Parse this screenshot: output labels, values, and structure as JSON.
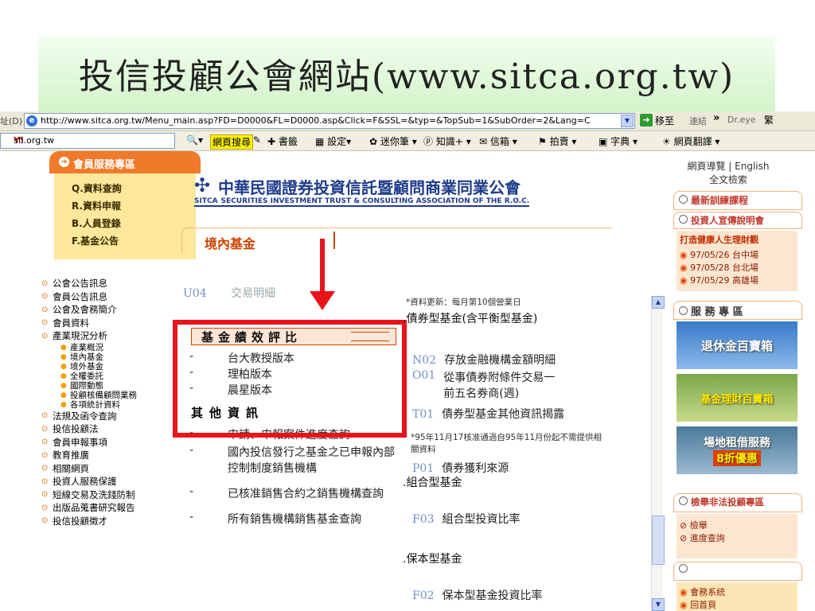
{
  "slide": {
    "title": "投信投顧公會網站(www.sitca.org.tw)"
  },
  "browser": {
    "address_label": "址(D)",
    "url": "http://www.sitca.org.tw/Menu_main.asp?FD=D0000&FL=D0000.asp&Click=F&SSL=&typ=&TopSub=1&SubOrder=2&Lang=C",
    "go_label": "移至",
    "links_label": "連結",
    "dreye_label": "Dr.eye",
    "dreye_extra": "繁",
    "search_value": "sfi.org.tw",
    "toolbar": {
      "web_search": "網頁搜尋",
      "bookmarks": "書籤",
      "settings": "設定",
      "notepad": "迷你筆",
      "knowledge": "知識+",
      "mail": "信箱",
      "auction": "拍賣",
      "dictionary": "字典",
      "translate": "網頁翻譯"
    }
  },
  "member_services": {
    "header": "會員服務專區",
    "items": [
      "Q.資料查詢",
      "R.資料申報",
      "B.人員登錄",
      "F.基金公告"
    ]
  },
  "nav": {
    "items_top": [
      "公會公告訊息",
      "會員公告訊息",
      "公會及會務簡介",
      "會員資料",
      "產業現況分析"
    ],
    "sub_items": [
      "產業概況",
      "境內基金",
      "境外基金",
      "全權委託",
      "國際動態",
      "投顧核備顧問業務",
      "各項統計資料"
    ],
    "items_bottom": [
      "法規及函令查詢",
      "投信投顧法",
      "會員申報事項",
      "教育推廣",
      "相關網頁",
      "投資人服務保護",
      "短線交易及洗錢防制",
      "出版品蒐書研究報告",
      "投信投顧徵才"
    ]
  },
  "logo": {
    "title": "中華民國證券投資信託暨顧問商業同業公會",
    "sub": "SECURITIES INVESTMENT TRUST & CONSULTING ASSOCIATION OF THE R.O.C.",
    "mark": "SITCA"
  },
  "section": {
    "title": "境內基金"
  },
  "middle": {
    "top_code": "U04",
    "top_item": "交易明細",
    "fund_perf_header": "基金績效評比",
    "fund_perf_items": [
      "台大教授版本",
      "理柏版本",
      "晨星版本"
    ],
    "other_header": "其他資訊",
    "other_items": [
      "申請、申報案件進度查詢",
      "國內投信發行之基金之已申報內部控制制度銷售機構",
      "已核准銷售合約之銷售機構查詢",
      "所有銷售機構銷售基金查詢"
    ]
  },
  "right": {
    "update_note": "*資料更新：每月第10個營業日",
    "bond_heading": ".債券型基金(含平衡型基金)",
    "n02_code": "N02",
    "n02_text": "存放金融機構金額明細",
    "o01_code": "O01",
    "o01_text": "從事債券附條件交易一前五名券商(週)",
    "t01_code": "T01",
    "t01_text": "債券型基金其他資訊揭露",
    "note2": "*95年11月17核准通過自95年11月份起不需提供相關資料",
    "p01_code": "P01",
    "p01_text": "債券獲利來源",
    "mixed_heading": ".組合型基金",
    "f03_code": "F03",
    "f03_text": "組合型投資比率",
    "guaranteed_heading": ".保本型基金",
    "f02_code": "F02",
    "f02_text": "保本型基金投資比率"
  },
  "right_panel": {
    "top_links": "網頁導覽 | English",
    "full_search": "全文檢索",
    "training": "最新訓練課程",
    "investor_promo": "投資人宣傳說明會",
    "promo_title": "打造健康人生理財觀",
    "promo_items": [
      "97/05/26 台中場",
      "97/05/28 台北場",
      "97/05/29 高雄場"
    ],
    "service_header": "服 務 專 區",
    "img1": "退休金百寶箱",
    "img2": "基金理財百寶箱",
    "img3_line1": "場地租借服務",
    "img3_line2": "8折優惠",
    "report_header": "檢舉非法投顧專區",
    "report_items": [
      "檢舉",
      "進度查詢"
    ],
    "bottom_items": [
      "會務系統",
      "回首頁"
    ]
  }
}
